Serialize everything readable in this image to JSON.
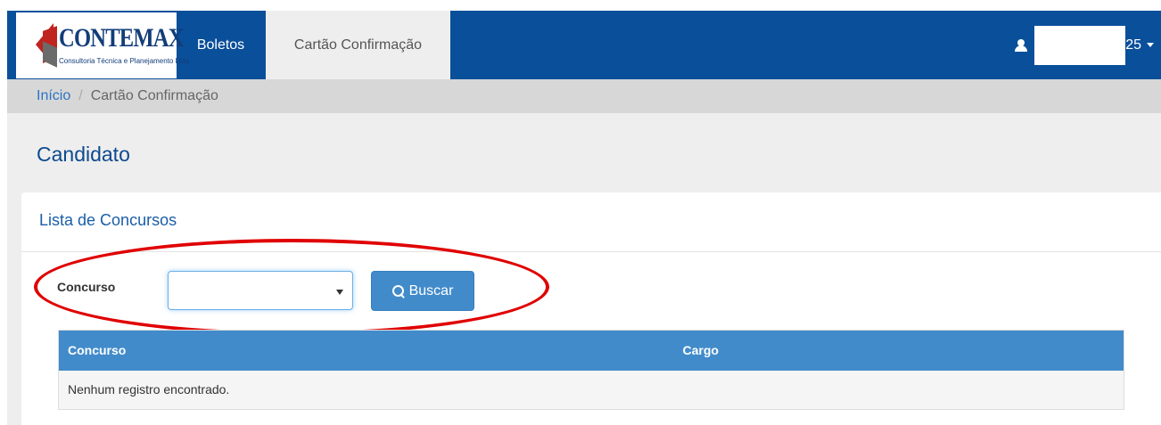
{
  "navbar": {
    "brand": {
      "name": "CONTEMAX",
      "tagline": "Consultoria Técnica e Planejamento Ltda"
    },
    "items": [
      {
        "label": "Boletos",
        "active": false
      },
      {
        "label": "Cartão Confirmação",
        "active": true
      }
    ],
    "user": {
      "visible_suffix": "25",
      "icon": "user-icon"
    }
  },
  "breadcrumb": {
    "home": "Início",
    "separator": "/",
    "current": "Cartão Confirmação"
  },
  "page": {
    "title": "Candidato"
  },
  "panel": {
    "title": "Lista de Concursos",
    "filter": {
      "label": "Concurso",
      "selected_value": "",
      "button_label": "Buscar",
      "button_icon": "search-icon"
    },
    "table": {
      "columns": [
        "Concurso",
        "Cargo"
      ],
      "empty_message": "Nenhum registro encontrado."
    }
  },
  "colors": {
    "navbar": "#0a4f9a",
    "primary": "#428bca",
    "highlight": "#e00000"
  }
}
